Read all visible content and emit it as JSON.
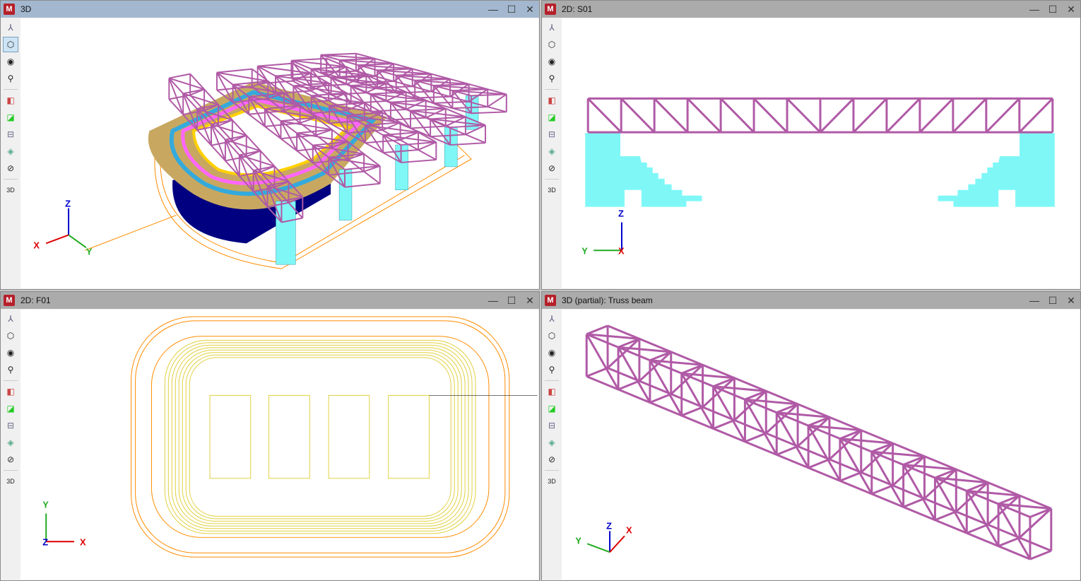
{
  "windows": [
    {
      "title": "3D",
      "active": true
    },
    {
      "title": "2D: S01",
      "active": false
    },
    {
      "title": "2D: F01",
      "active": false
    },
    {
      "title": "3D (partial): Truss beam",
      "active": false
    }
  ],
  "toolbar": {
    "icons": [
      "axes-icon",
      "view-cube-icon",
      "orbit-icon",
      "rotate-axis-icon",
      "section-plane-x-icon",
      "section-plane-diagonal-icon",
      "section-plane-horizontal-icon",
      "layers-icon",
      "hide-icon",
      "3d-settings-icon"
    ],
    "label_3d": "3D"
  },
  "controls": {
    "minimize": "—",
    "maximize": "☐",
    "close": "✕"
  },
  "axes": {
    "x": "X",
    "y": "Y",
    "z": "Z"
  },
  "colors": {
    "truss": "#b05aa6",
    "column": "#7ff7f7",
    "outline": "#ff8c00",
    "plan": "#e0d040",
    "base": "#000080",
    "active_title": "#a3b8cf",
    "inactive_title": "#ababab"
  }
}
